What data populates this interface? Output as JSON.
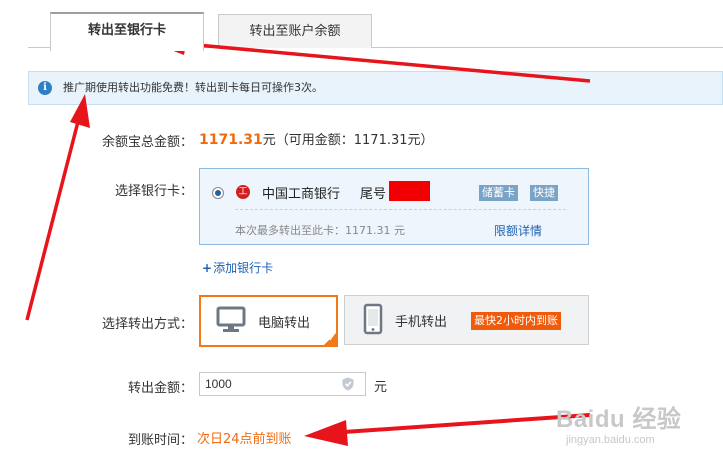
{
  "tabs": [
    {
      "label": "转出至银行卡",
      "active": true
    },
    {
      "label": "转出至账户余额",
      "active": false
    }
  ],
  "notice": {
    "icon": "info-icon",
    "text": "推广期使用转出功能免费！转出到卡每日可操作3次。"
  },
  "balance": {
    "label": "余额宝总金额：",
    "amount": "1171.31",
    "suffix": "元（可用金额：1171.31元）"
  },
  "bank_card": {
    "label": "选择银行卡：",
    "bank_name": "中国工商银行",
    "tail_label": "尾号",
    "badges": [
      "储蓄卡",
      "快捷"
    ],
    "limit_text": "本次最多转出至此卡：1171.31 元",
    "limit_link": "限额详情",
    "add_card": "添加银行卡"
  },
  "method": {
    "label": "选择转出方式：",
    "options": [
      {
        "label": "电脑转出",
        "icon": "monitor-icon",
        "selected": true
      },
      {
        "label": "手机转出",
        "icon": "phone-icon",
        "selected": false,
        "badge": "最快2小时内到账"
      }
    ]
  },
  "amount": {
    "label": "转出金额：",
    "value": "1000",
    "unit": "元"
  },
  "arrival": {
    "label": "到账时间：",
    "value": "次日24点前到账"
  },
  "watermark": {
    "brand": "Baidu 经验",
    "url": "jingyan.baidu.com"
  },
  "colors": {
    "accent": "#f06b10",
    "link": "#1c62b3",
    "annotation_arrow": "#e8141b"
  }
}
